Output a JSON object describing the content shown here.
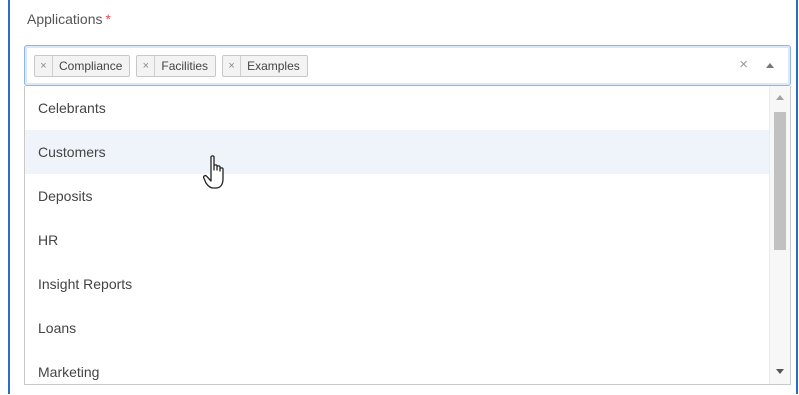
{
  "field": {
    "label": "Applications",
    "required_mark": "*"
  },
  "selected_tags": [
    {
      "remove_glyph": "×",
      "label": "Compliance"
    },
    {
      "remove_glyph": "×",
      "label": "Facilities"
    },
    {
      "remove_glyph": "×",
      "label": "Examples"
    }
  ],
  "controls": {
    "clear_glyph": "×"
  },
  "options": [
    {
      "label": "Celebrants"
    },
    {
      "label": "Customers",
      "hovered": true
    },
    {
      "label": "Deposits"
    },
    {
      "label": "HR"
    },
    {
      "label": "Insight Reports"
    },
    {
      "label": "Loans"
    },
    {
      "label": "Marketing"
    }
  ],
  "colors": {
    "focus_border": "#2b6cc4",
    "required": "#d9534f",
    "hover_row": "#eef4fa"
  },
  "icons": {
    "cursor": "hand-pointer-icon",
    "toggle": "caret-up-icon",
    "clear": "close-icon"
  }
}
